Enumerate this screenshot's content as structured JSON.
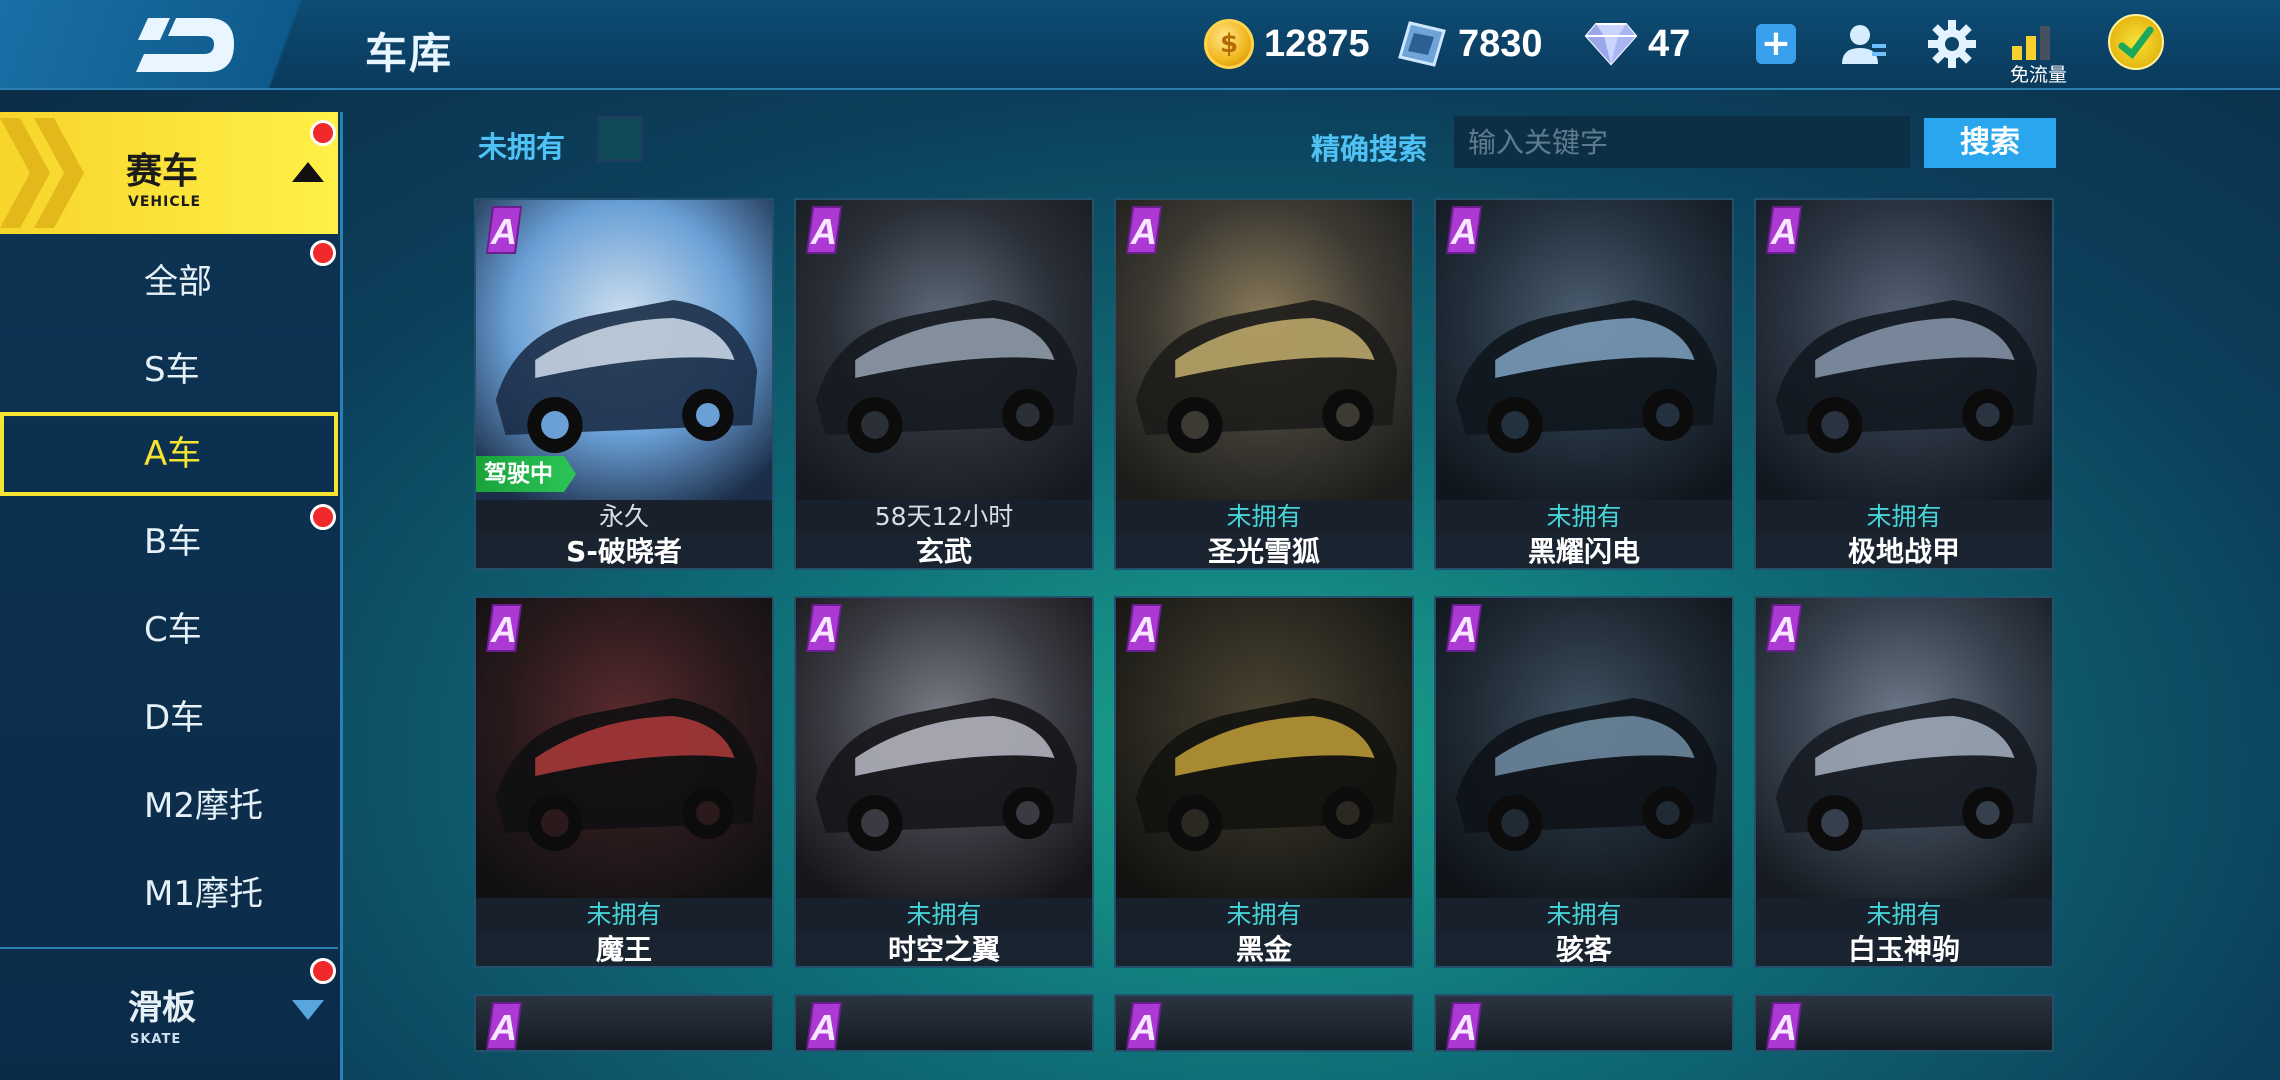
{
  "header": {
    "title": "车库",
    "currencies": [
      {
        "icon": "gold-coin-icon",
        "value": "12875"
      },
      {
        "icon": "voucher-card-icon",
        "value": "7830"
      },
      {
        "icon": "diamond-icon",
        "value": "47"
      }
    ],
    "signal_label": "免流量"
  },
  "sidebar": {
    "category": {
      "label": "赛车",
      "sublabel": "VEHICLE"
    },
    "items": [
      {
        "label": "全部"
      },
      {
        "label": "S车"
      },
      {
        "label": "A车"
      },
      {
        "label": "B车"
      },
      {
        "label": "C车"
      },
      {
        "label": "D车"
      },
      {
        "label": "M2摩托"
      },
      {
        "label": "M1摩托"
      }
    ],
    "skate": {
      "label": "滑板",
      "sublabel": "SKATE"
    }
  },
  "filter": {
    "not_owned_label": "未拥有",
    "search_label": "精确搜索",
    "search_placeholder": "输入关键字",
    "search_button": "搜索"
  },
  "colors": {
    "accent_yellow": "#f7e431",
    "status_not_owned": "#46d3d8",
    "search_button": "#2aa6ee",
    "driving_badge": "#18a33a"
  },
  "cards": [
    {
      "grade": "A",
      "status": "永久",
      "name": "S-破晓者",
      "badge": "驾驶中"
    },
    {
      "grade": "A",
      "status": "58天12小时",
      "name": "玄武"
    },
    {
      "grade": "A",
      "status": "未拥有",
      "name": "圣光雪狐"
    },
    {
      "grade": "A",
      "status": "未拥有",
      "name": "黑耀闪电"
    },
    {
      "grade": "A",
      "status": "未拥有",
      "name": "极地战甲"
    },
    {
      "grade": "A",
      "status": "未拥有",
      "name": "魔王"
    },
    {
      "grade": "A",
      "status": "未拥有",
      "name": "时空之翼"
    },
    {
      "grade": "A",
      "status": "未拥有",
      "name": "黑金"
    },
    {
      "grade": "A",
      "status": "未拥有",
      "name": "骇客"
    },
    {
      "grade": "A",
      "status": "未拥有",
      "name": "白玉神驹"
    }
  ],
  "partial_cards": [
    {
      "grade": "A"
    },
    {
      "grade": "A"
    },
    {
      "grade": "A"
    },
    {
      "grade": "A"
    },
    {
      "grade": "A"
    }
  ]
}
